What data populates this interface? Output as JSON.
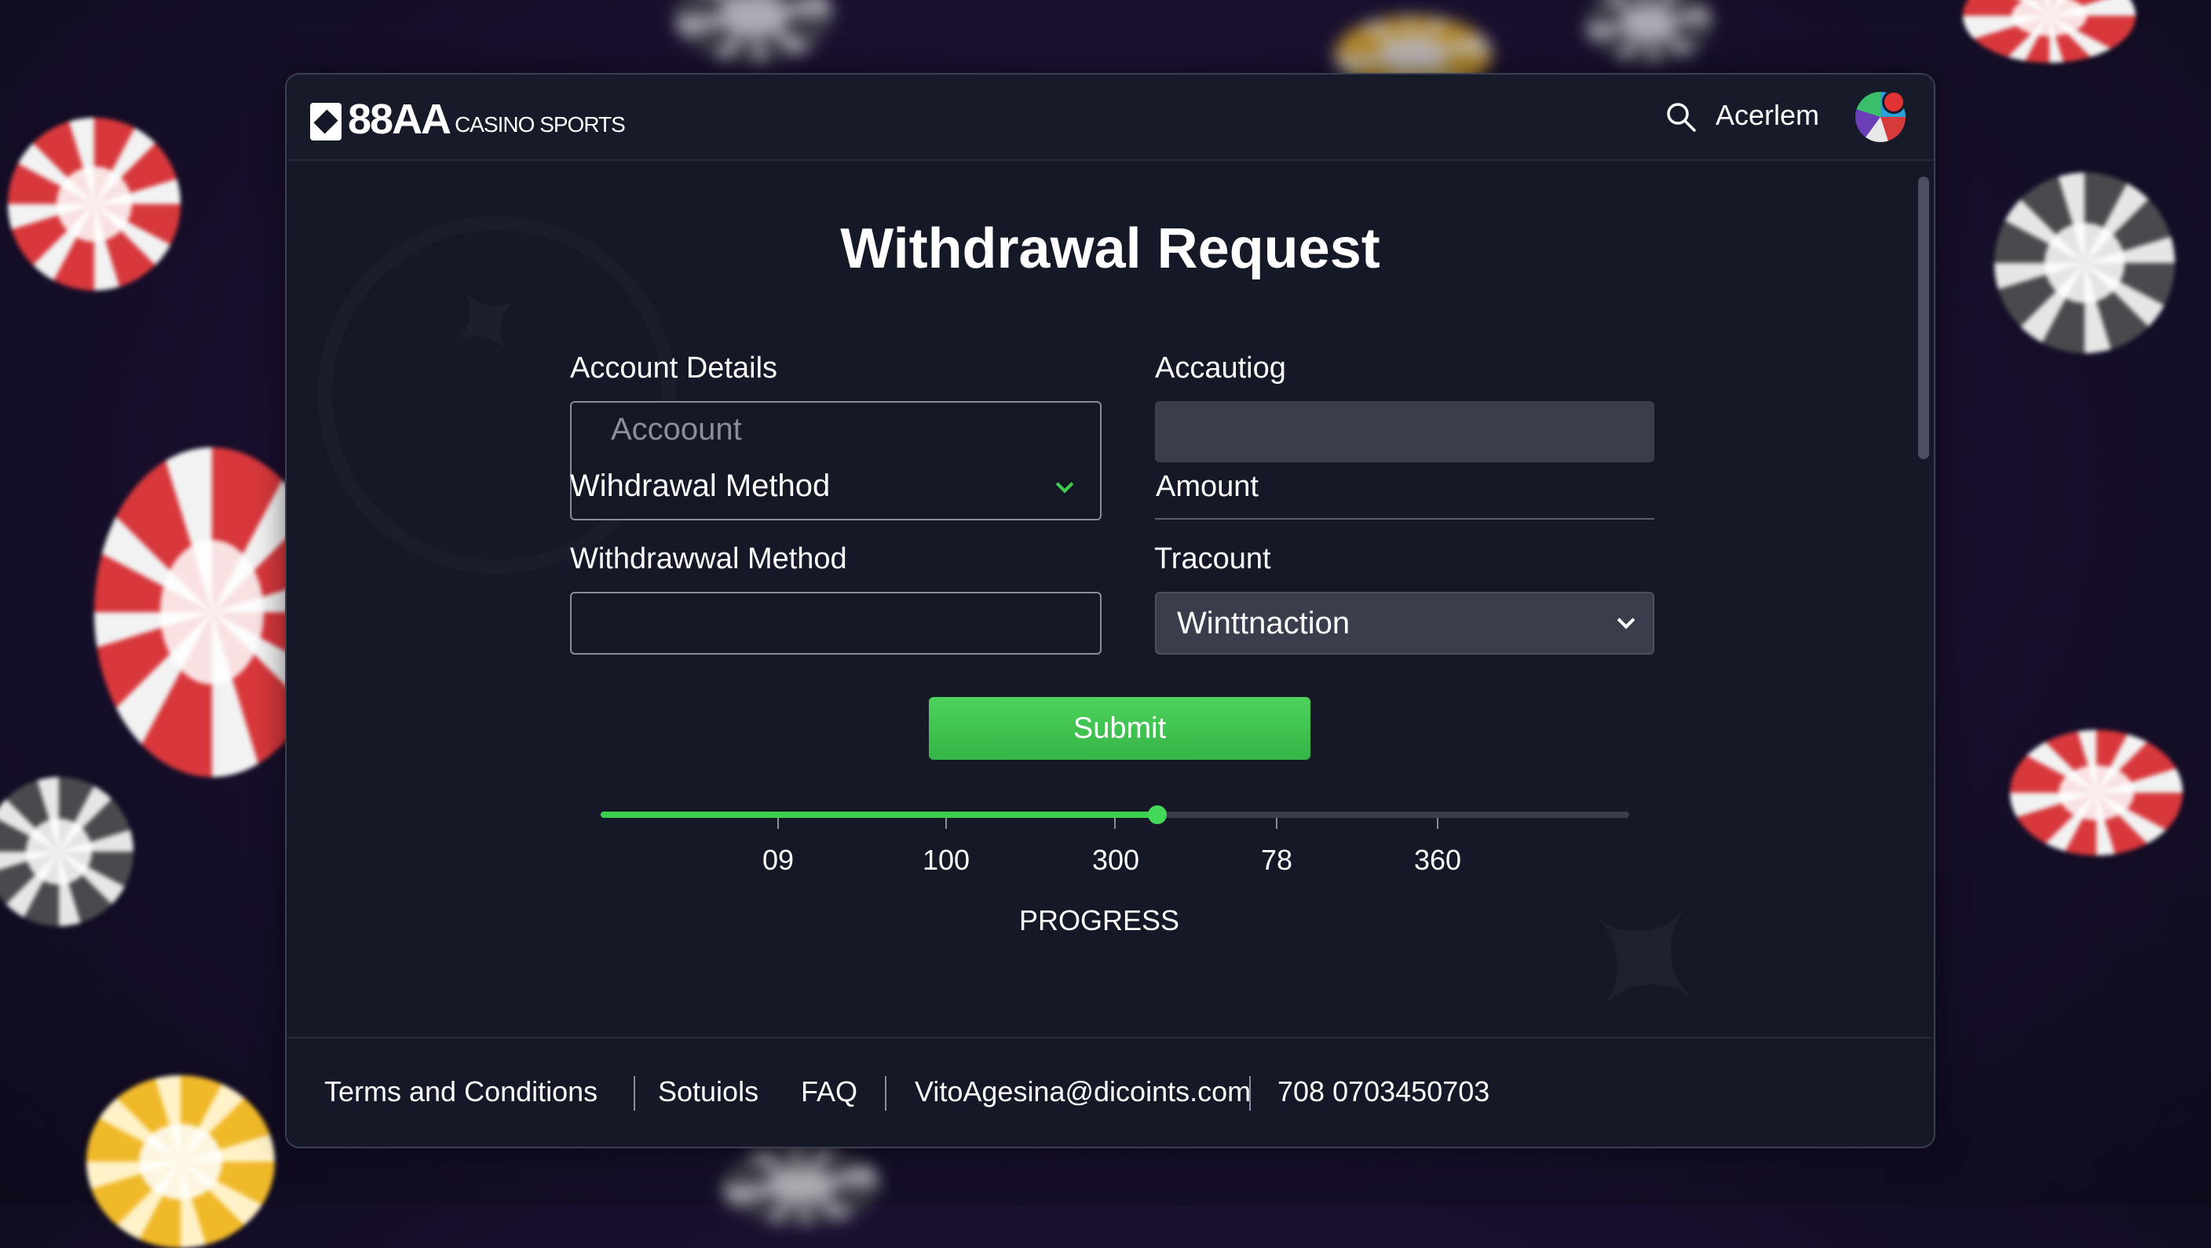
{
  "brand": {
    "name": "88AA",
    "tagline": "CASINO SPORTS"
  },
  "header": {
    "search_icon": "search-icon",
    "username": "Acerlem",
    "avatar_icon": "avatar"
  },
  "form": {
    "title": "Withdrawal Request",
    "account_details": {
      "label": "Account Details",
      "placeholder": "Accoount",
      "method_value": "Wihdrawal Method"
    },
    "accautiog": {
      "label": "Accautiog",
      "value": "",
      "amount_label": "Amount"
    },
    "withdrawal_method": {
      "label": "Withdrawwal Method",
      "value": ""
    },
    "tracount": {
      "label": "Tracount",
      "selected": "Winttnaction"
    },
    "submit_label": "Submit"
  },
  "progress": {
    "label": "PROGRESS",
    "value_fraction": 0.541,
    "ticks": [
      "09",
      "100",
      "300",
      "78",
      "360"
    ]
  },
  "footer": {
    "links": [
      "Terms and Conditions",
      "Sotuiols",
      "FAQ"
    ],
    "email": "VitoAgesina@dicoints.com",
    "phone": "708 0703450703"
  },
  "colors": {
    "accent_green": "#3bcf4d",
    "panel_bg": "#151826",
    "field_fill": "#3a3e4c",
    "background": "#1a1030"
  }
}
